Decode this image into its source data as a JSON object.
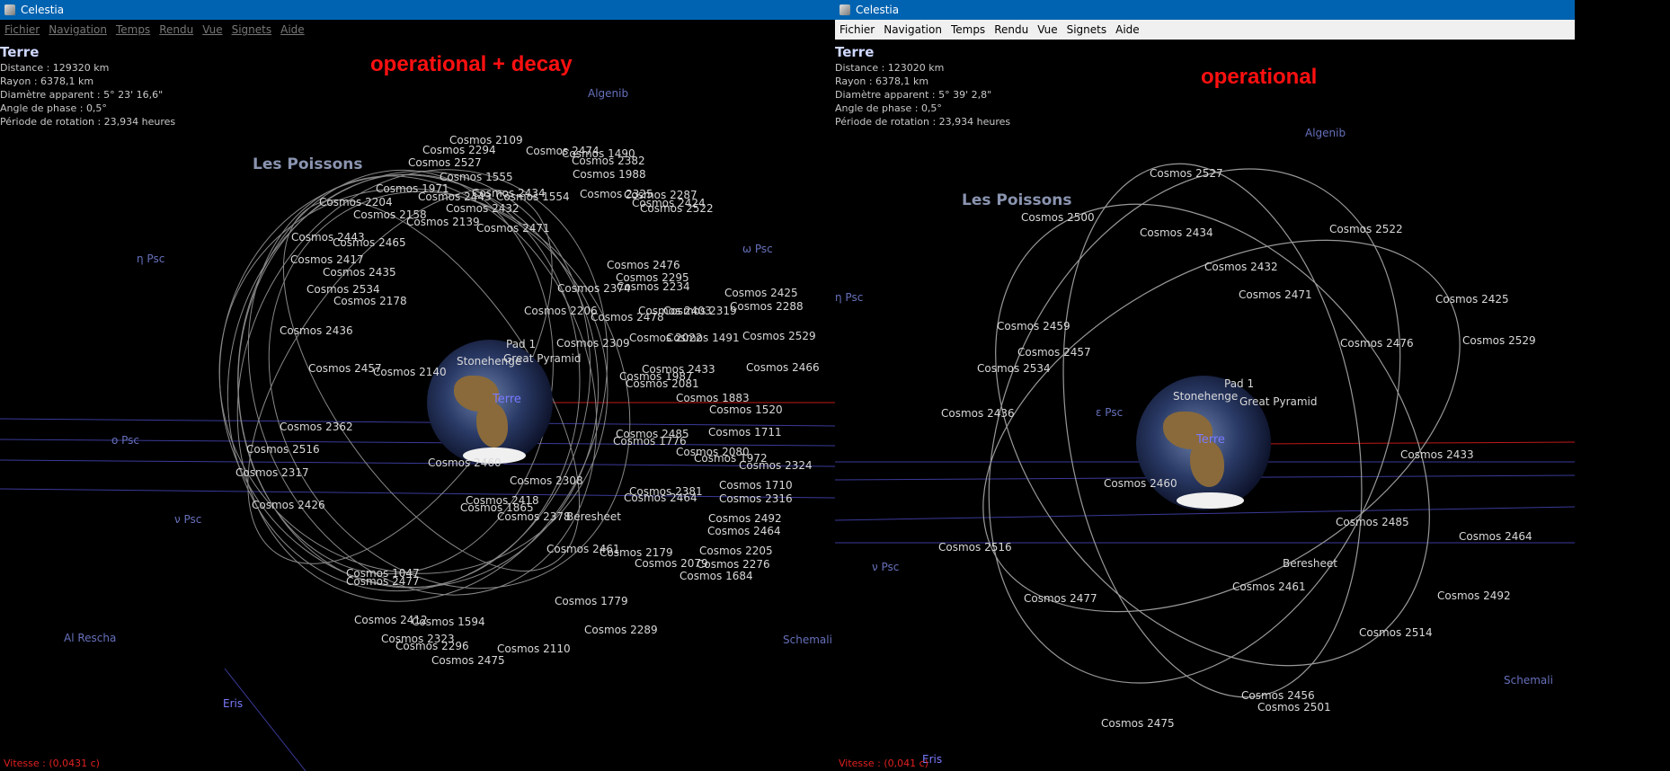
{
  "left": {
    "title": "Celestia",
    "menu": [
      "Fichier",
      "Navigation",
      "Temps",
      "Rendu",
      "Vue",
      "Signets",
      "Aide"
    ],
    "info": {
      "object": "Terre",
      "distance": "Distance : 129320 km",
      "radius": "Rayon : 6378,1 km",
      "diameter": "Diamètre apparent : 5° 23' 16,6\"",
      "phase": "Angle de phase : 0,5°",
      "rotation": "Période de rotation : 23,934 heures"
    },
    "headline": "operational + decay",
    "speed": "Vitesse : (0,0431 c)",
    "constellation": "Les Poissons",
    "stars": [
      "Algenib",
      "η Psc",
      "ω Psc",
      "ο Psc",
      "ν Psc",
      "Al Rescha",
      "Schemali"
    ],
    "eris": "Eris",
    "earth_label": "Terre",
    "satellites": [
      "Cosmos 2109",
      "Cosmos 2294",
      "Cosmos 2474",
      "Cosmos 1490",
      "Cosmos 2527",
      "Cosmos 2382",
      "Cosmos 1988",
      "Cosmos 1555",
      "Cosmos 1971",
      "Cosmos 2434",
      "Cosmos 2325",
      "Cosmos 2287",
      "Cosmos 2443",
      "Cosmos 1554",
      "Cosmos 2424",
      "Cosmos 2522",
      "Cosmos 2204",
      "Cosmos 2432",
      "Cosmos 2158",
      "Cosmos 2139",
      "Cosmos 2471",
      "Cosmos 2443",
      "Cosmos 2465",
      "Cosmos 2417",
      "Cosmos 2435",
      "Cosmos 2476",
      "Cosmos 2295",
      "Cosmos 2374",
      "Cosmos 2234",
      "Cosmos 2425",
      "Cosmos 2288",
      "Cosmos 2534",
      "Cosmos 2178",
      "Cosmos 2206",
      "Cosmos 2478",
      "Cosmos 2403",
      "Cosmos 2319",
      "Cosmos 2436",
      "Cosmos 2022",
      "Cosmos 1491",
      "Cosmos 2529",
      "Cosmos 2309",
      "Cosmos 2466",
      "Cosmos 2457",
      "Cosmos 2140",
      "Cosmos 2433",
      "Cosmos 1987",
      "Cosmos 2081",
      "Cosmos 1883",
      "Cosmos 1520",
      "Cosmos 2362",
      "Cosmos 2485",
      "Cosmos 1711",
      "Cosmos 2516",
      "Cosmos 1776",
      "Cosmos 2080",
      "Cosmos 1972",
      "Cosmos 2324",
      "Cosmos 2317",
      "Cosmos 2460",
      "Cosmos 2308",
      "Cosmos 2381",
      "Cosmos 1710",
      "Cosmos 2426",
      "Cosmos 2418",
      "Cosmos 2464",
      "Cosmos 2316",
      "Cosmos 1865",
      "Cosmos 2378",
      "Cosmos 2492",
      "Cosmos 2464",
      "Cosmos 2461",
      "Cosmos 2179",
      "Cosmos 2205",
      "Cosmos 2079",
      "Cosmos 2276",
      "Cosmos 1047",
      "Cosmos 2477",
      "Cosmos 1684",
      "Cosmos 1779",
      "Cosmos 1594",
      "Cosmos 2412",
      "Cosmos 2289",
      "Cosmos 2323",
      "Cosmos 2296",
      "Cosmos 2110",
      "Cosmos 2475",
      "Beresheet",
      "Stonehenge",
      "Pad 1",
      "Great Pyramid"
    ]
  },
  "right": {
    "title": "Celestia",
    "menu": [
      "Fichier",
      "Navigation",
      "Temps",
      "Rendu",
      "Vue",
      "Signets",
      "Aide"
    ],
    "info": {
      "object": "Terre",
      "distance": "Distance : 123020 km",
      "radius": "Rayon : 6378,1 km",
      "diameter": "Diamètre apparent : 5° 39' 2,8\"",
      "phase": "Angle de phase : 0,5°",
      "rotation": "Période de rotation : 23,934 heures"
    },
    "headline": "operational",
    "speed": "Vitesse : (0,041 c)",
    "constellation": "Les Poissons",
    "stars": [
      "Algenib",
      "η Psc",
      "ε Psc",
      "ν Psc",
      "Schemali"
    ],
    "eris": "Eris",
    "earth_label": "Terre",
    "satellites": [
      "Cosmos 2527",
      "Cosmos 2500",
      "Cosmos 2434",
      "Cosmos 2522",
      "Cosmos 2432",
      "Cosmos 2471",
      "Cosmos 2425",
      "Cosmos 2459",
      "Cosmos 2476",
      "Cosmos 2529",
      "Cosmos 2457",
      "Cosmos 2534",
      "Cosmos 2436",
      "Cosmos 2433",
      "Cosmos 2460",
      "Cosmos 2485",
      "Cosmos 2464",
      "Cosmos 2516",
      "Beresheet",
      "Cosmos 2461",
      "Cosmos 2492",
      "Cosmos 2477",
      "Cosmos 2514",
      "Cosmos 2456",
      "Cosmos 2501",
      "Cosmos 2475",
      "Stonehenge",
      "Pad 1",
      "Great Pyramid"
    ]
  }
}
